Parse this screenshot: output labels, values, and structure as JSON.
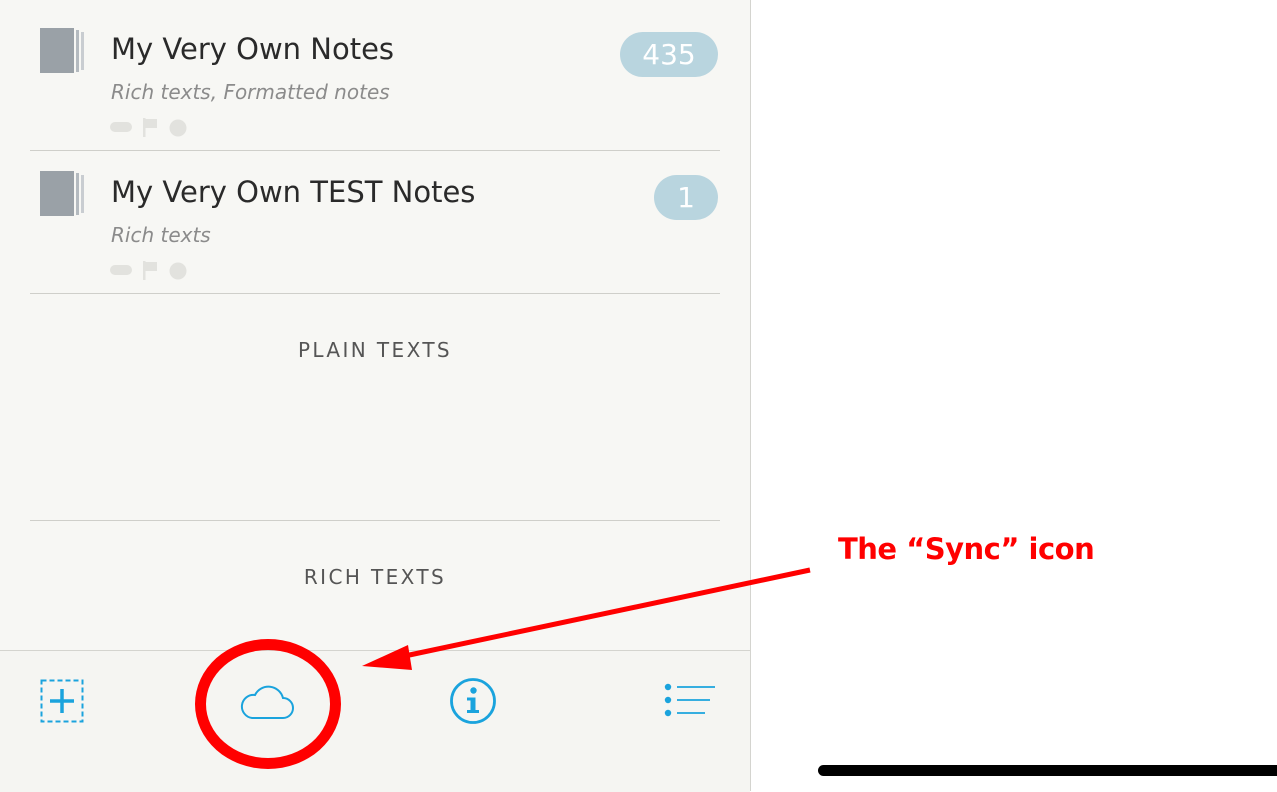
{
  "notebooks": [
    {
      "title": "My Very Own Notes",
      "subtitle": "Rich texts, Formatted notes",
      "count": "435",
      "icon": "notebook-icon"
    },
    {
      "title": "My Very Own TEST Notes",
      "subtitle": "Rich texts",
      "count": "1",
      "icon": "notebook-icon"
    }
  ],
  "sections": {
    "plain": "PLAIN TEXTS",
    "rich": "RICH TEXTS"
  },
  "toolbar": {
    "add_icon": "add-icon",
    "sync_icon": "cloud-icon",
    "info_icon": "info-icon",
    "list_icon": "list-icon"
  },
  "annotation": {
    "label": "The “Sync” icon"
  },
  "colors": {
    "accent": "#1aa3dd",
    "badge": "#b9d5df",
    "annotation": "#ff0000",
    "panel_bg": "#f7f7f4"
  }
}
